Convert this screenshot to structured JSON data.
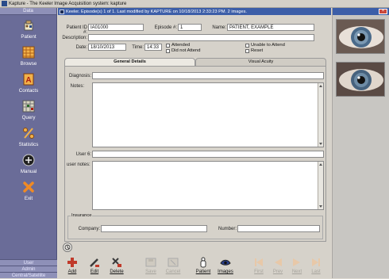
{
  "window": {
    "title": "Kapture - The Keeler Image Acquisition system: kapture"
  },
  "sidebar": {
    "header": "Data",
    "items": [
      {
        "label": "Patient",
        "icon": "patient-icon"
      },
      {
        "label": "Browse",
        "icon": "browse-icon"
      },
      {
        "label": "Contacts",
        "icon": "contacts-icon"
      },
      {
        "label": "Query",
        "icon": "query-icon"
      },
      {
        "label": "Statistics",
        "icon": "statistics-icon"
      },
      {
        "label": "Manual",
        "icon": "manual-icon"
      },
      {
        "label": "Exit",
        "icon": "exit-icon"
      }
    ],
    "footer": [
      "User",
      "Admin",
      "Central/Satellite"
    ]
  },
  "record": {
    "status_text": "Keeler. Episode(s) 1 of 1. Last modified by KAPTURE on 10/18/2013 2:33:23 PM. 2 images.",
    "patient_id_label": "Patient ID #:",
    "patient_id": "IA01000",
    "episode_label": "Episode #:",
    "episode": "1",
    "name_label": "Name:",
    "name": "PATIENT, EXAMPLE",
    "description_label": "Description:",
    "description": "",
    "date_label": "Date:",
    "date": "18/10/2013",
    "time_label": "Time:",
    "time": "14:33",
    "attended": "Attended",
    "did_not_attend": "Did not Attend",
    "unable_to_attend": "Unable to Attend",
    "reset": "Reset"
  },
  "tabs": [
    "General Details",
    "Visual Acuity"
  ],
  "details": {
    "diagnosis_label": "Diagnosis:",
    "diagnosis": "",
    "notes_label": "Notes:",
    "user6_label": "User 6:",
    "user6": "",
    "user_notes_label": "user notes:",
    "insurance_label": "Insurance",
    "company_label": "Company:",
    "company": "",
    "number_label": "Number:",
    "number": ""
  },
  "toolbar": {
    "add": "Add",
    "edit": "Edit",
    "delete": "Delete",
    "save": "Save",
    "cancel": "Cancel",
    "patient": "Patient",
    "images": "Images",
    "first": "First",
    "prev": "Prev",
    "next": "Next",
    "last": "Last"
  },
  "colors": {
    "sidebar": "#6a6c98",
    "accent": "#3c5ea8",
    "add": "#c03a2a",
    "disabled": "#a6a39c"
  }
}
